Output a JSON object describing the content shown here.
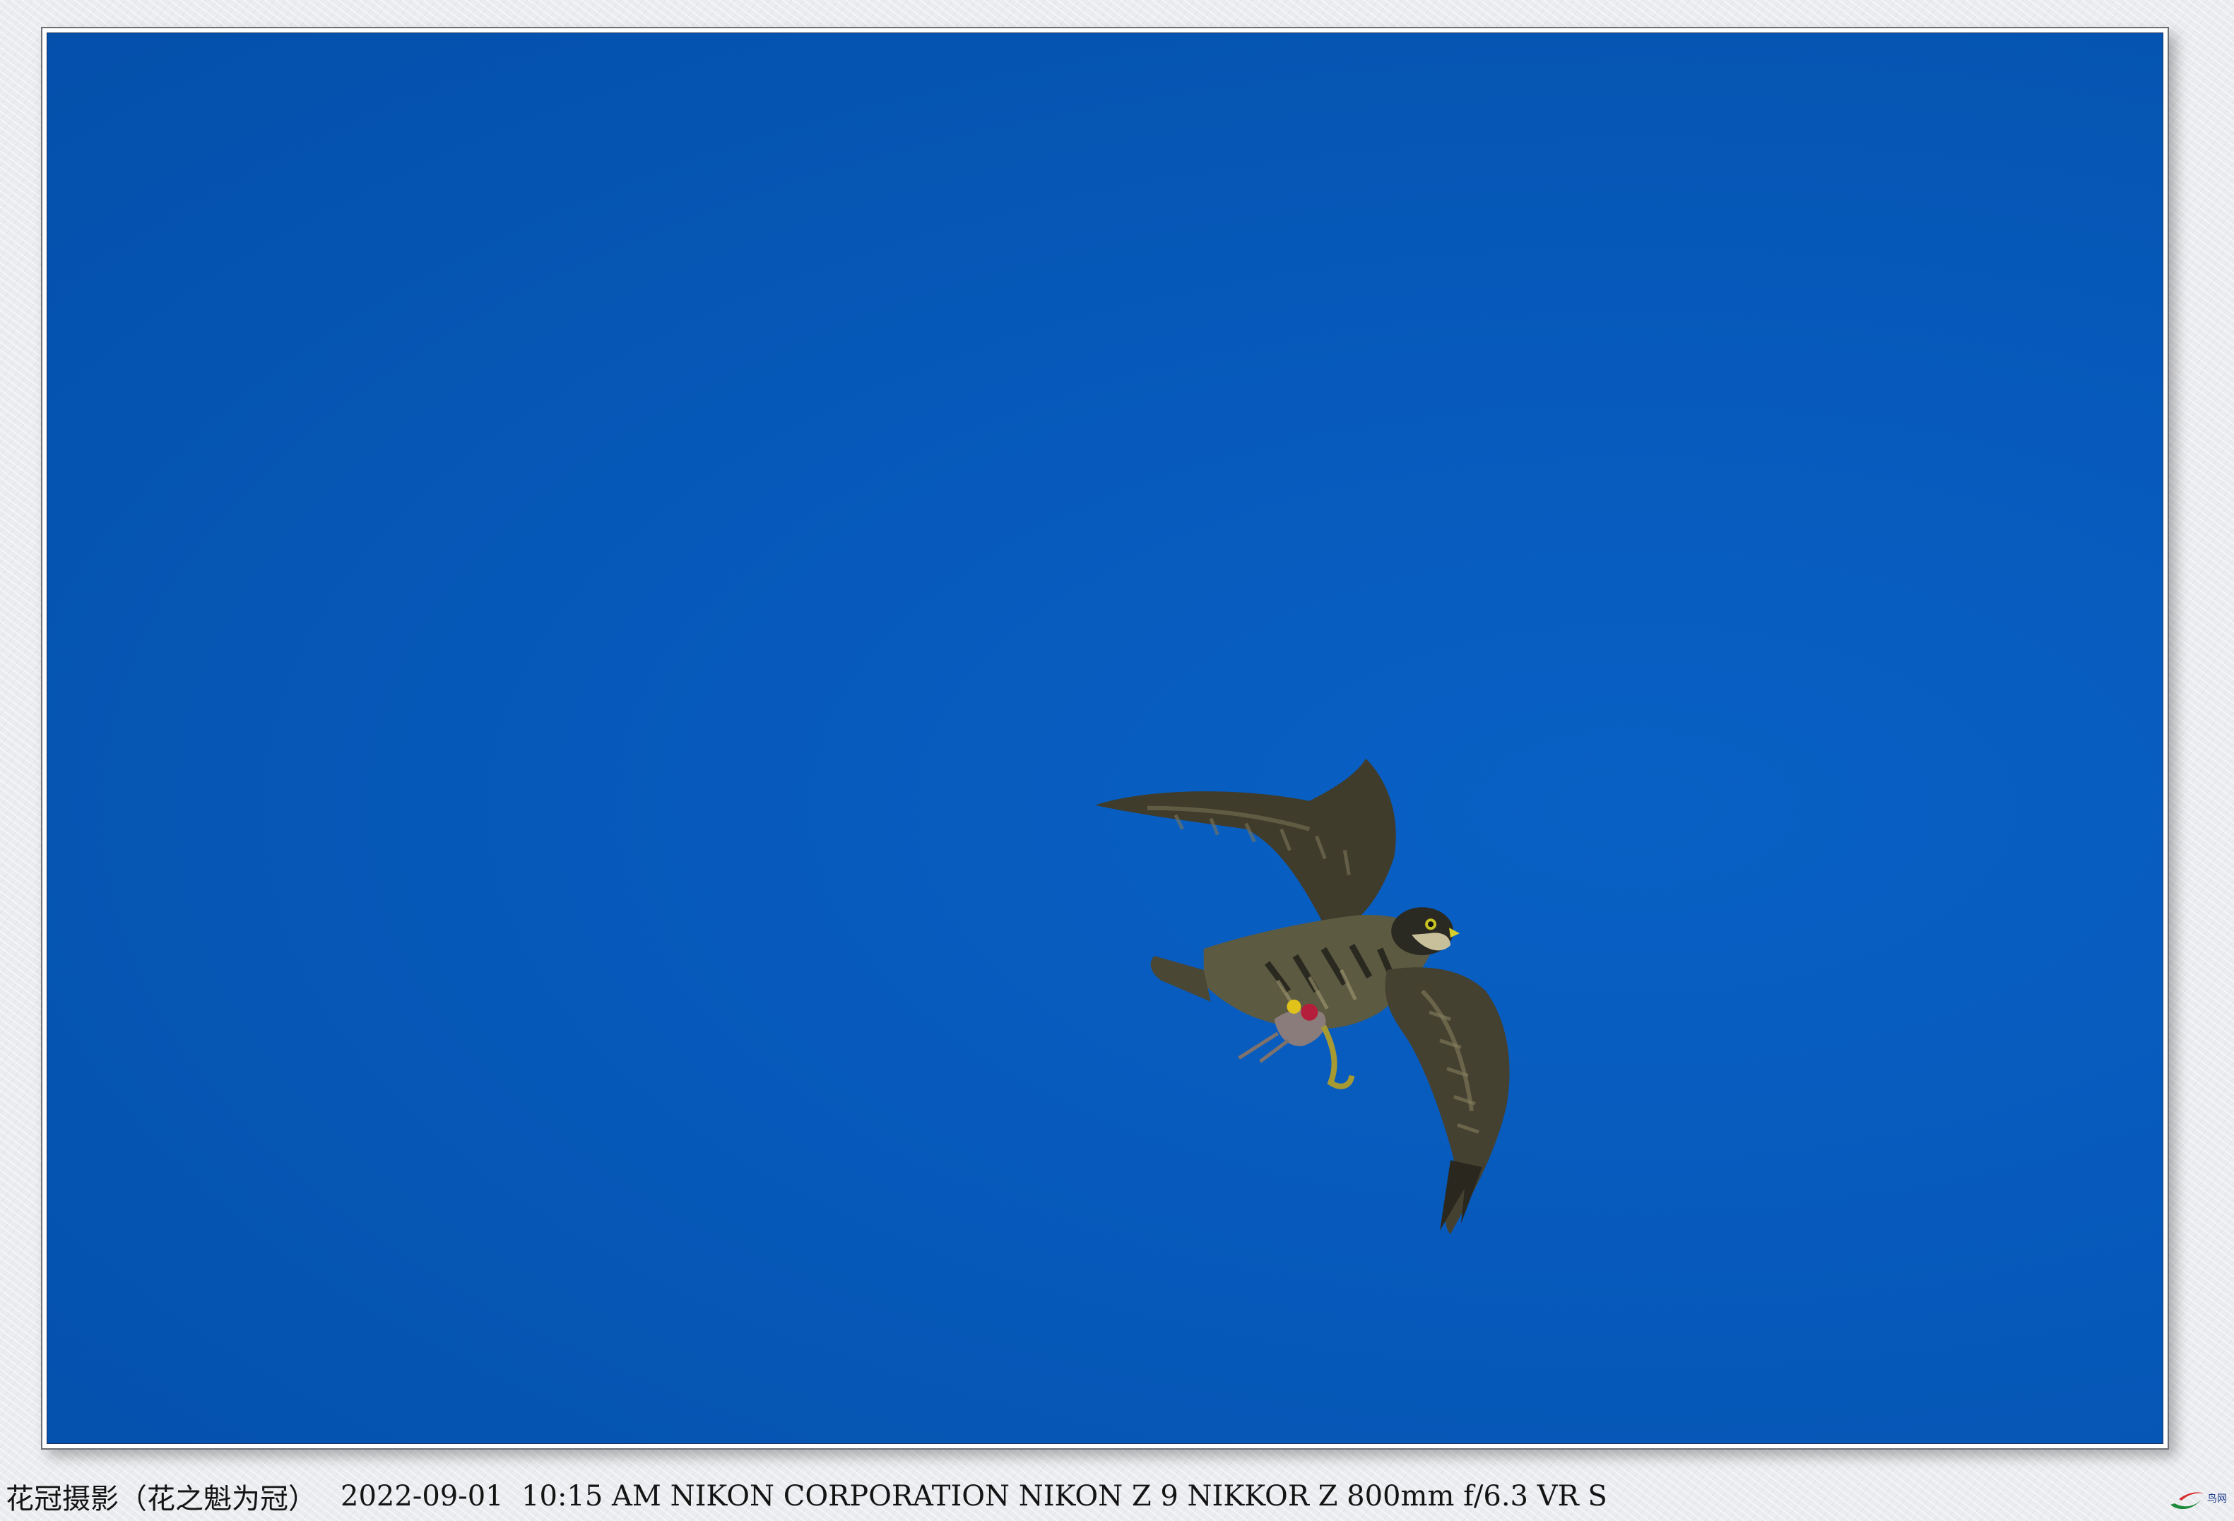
{
  "photo": {
    "subject": "falcon-in-flight-with-prey",
    "sky_color": "#0557b6"
  },
  "caption": {
    "author": "花冠摄影（花之魁为冠）",
    "meta": "2022-09-01  10:15 AM NIKON CORPORATION NIKON Z 9 NIKKOR Z 800mm f/6.3 VR S"
  },
  "logo": {
    "text": "鸟网",
    "icon": "swoosh-logo-icon"
  }
}
